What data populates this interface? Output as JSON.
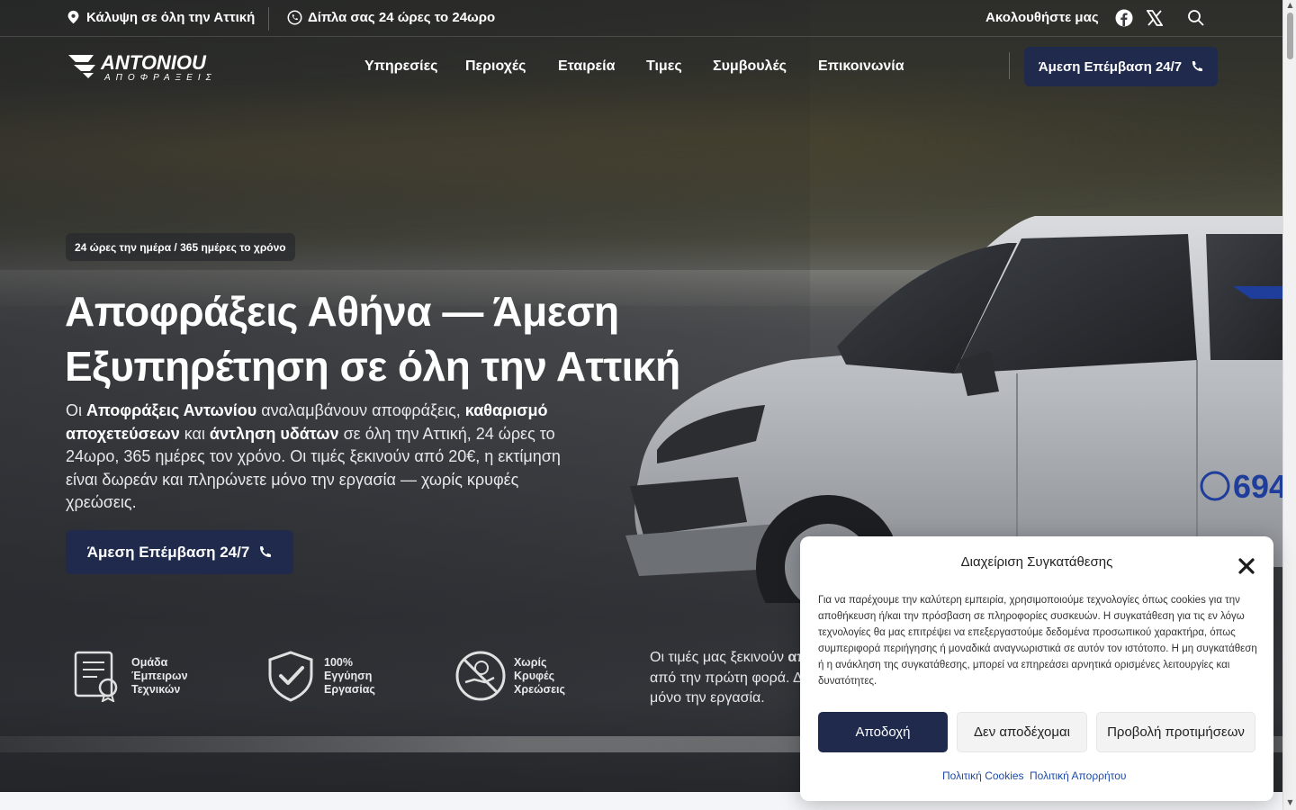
{
  "topbar": {
    "coverage": "Κάλυψη σε όλη την Αττική",
    "hours": "Δίπλα σας 24 ώρες το 24ωρο",
    "follow": "Ακολουθήστε μας"
  },
  "brand": {
    "logo_top": "ANTONIOU",
    "logo_bottom": "ΑΠΟΦΡΑΞΕΙΣ"
  },
  "nav": {
    "items": [
      "Υπηρεσίες",
      "Περιοχές",
      "Εταιρεία",
      "Τιμες",
      "Συμβουλές",
      "Επικοινωνία"
    ],
    "cta": "Άμεση Επέμβαση 24/7"
  },
  "hero": {
    "badge": "24 ώρες την ημέρα / 365 ημέρες το χρόνο",
    "title": "Αποφράξεις Αθήνα — Άμεση Εξυπηρέτηση σε όλη την Αττική",
    "lead": {
      "p1": "Οι ",
      "b1": "Αποφράξεις Αντωνίου",
      "p2": " αναλαμβάνουν αποφράξεις, ",
      "b2": "καθαρισμό αποχετεύσεων",
      "p3": " και ",
      "b3": "άντληση υδάτων",
      "p4": " σε όλη την Αττική, 24 ώρες το 24ωρο, 365 ημέρες τον χρόνο. Οι τιμές ξεκινούν από 20€, η εκτίμηση είναι δωρεάν και πληρώνετε μόνο την εργασία — χωρίς κρυφές χρεώσεις."
    },
    "cta": "Άμεση Επέμβαση 24/7",
    "van_phone": "694"
  },
  "features": [
    {
      "icon": "certificate-icon",
      "label": "Ομάδα Έμπειρων Τεχνικών"
    },
    {
      "icon": "shield-check-icon",
      "label": "100% Εγγύηση Εργασίας"
    },
    {
      "icon": "no-hidden-fees-icon",
      "label": "Χωρίς Κρυφές Χρεώσεις"
    }
  ],
  "side_text": {
    "l1a": "Οι τιμές μας ξεκινούν ",
    "l1b": "απ",
    "l2": "από την πρώτη φορά. Δε",
    "l3": "μόνο την εργασία."
  },
  "consent": {
    "title": "Διαχείριση Συγκατάθεσης",
    "body": "Για να παρέχουμε την καλύτερη εμπειρία, χρησιμοποιούμε τεχνολογίες όπως cookies για την αποθήκευση ή/και την πρόσβαση σε πληροφορίες συσκευών. Η συγκατάθεση για τις εν λόγω τεχνολογίες θα μας επιτρέψει να επεξεργαστούμε δεδομένα προσωπικού χαρακτήρα, όπως συμπεριφορά περιήγησης ή μοναδικά αναγνωριστικά σε αυτόν τον ιστότοπο. Η μη συγκατάθεση ή η ανάκληση της συγκατάθεσης, μπορεί να επηρεάσει αρνητικά ορισμένες λειτουργίες και δυνατότητες.",
    "accept": "Αποδοχή",
    "deny": "Δεν αποδέχομαι",
    "prefs": "Προβολή προτιμήσεων",
    "cookies_link": "Πολιτική Cookies",
    "privacy_link": "Πολιτική Απορρήτου"
  },
  "colors": {
    "brand_navy": "#1f2a4d",
    "link_blue": "#1f4aa8"
  }
}
